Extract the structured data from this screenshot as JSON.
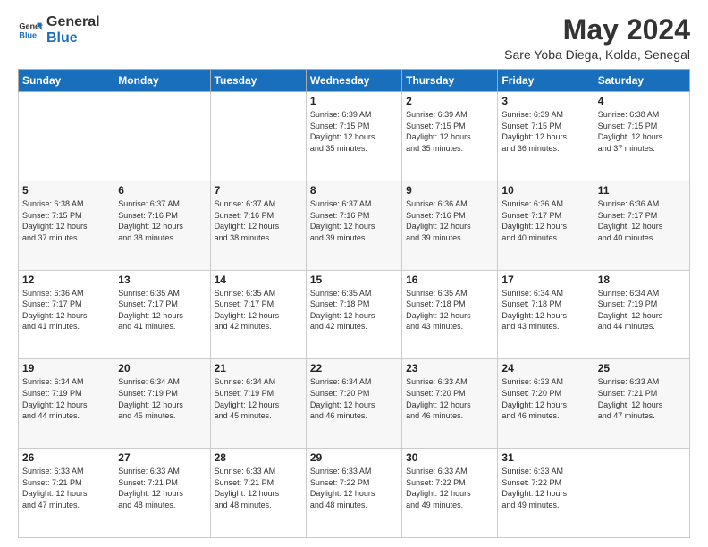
{
  "logo": {
    "line1": "General",
    "line2": "Blue"
  },
  "header": {
    "month_year": "May 2024",
    "location": "Sare Yoba Diega, Kolda, Senegal"
  },
  "days_of_week": [
    "Sunday",
    "Monday",
    "Tuesday",
    "Wednesday",
    "Thursday",
    "Friday",
    "Saturday"
  ],
  "weeks": [
    [
      {
        "day": "",
        "info": ""
      },
      {
        "day": "",
        "info": ""
      },
      {
        "day": "",
        "info": ""
      },
      {
        "day": "1",
        "info": "Sunrise: 6:39 AM\nSunset: 7:15 PM\nDaylight: 12 hours\nand 35 minutes."
      },
      {
        "day": "2",
        "info": "Sunrise: 6:39 AM\nSunset: 7:15 PM\nDaylight: 12 hours\nand 35 minutes."
      },
      {
        "day": "3",
        "info": "Sunrise: 6:39 AM\nSunset: 7:15 PM\nDaylight: 12 hours\nand 36 minutes."
      },
      {
        "day": "4",
        "info": "Sunrise: 6:38 AM\nSunset: 7:15 PM\nDaylight: 12 hours\nand 37 minutes."
      }
    ],
    [
      {
        "day": "5",
        "info": "Sunrise: 6:38 AM\nSunset: 7:15 PM\nDaylight: 12 hours\nand 37 minutes."
      },
      {
        "day": "6",
        "info": "Sunrise: 6:37 AM\nSunset: 7:16 PM\nDaylight: 12 hours\nand 38 minutes."
      },
      {
        "day": "7",
        "info": "Sunrise: 6:37 AM\nSunset: 7:16 PM\nDaylight: 12 hours\nand 38 minutes."
      },
      {
        "day": "8",
        "info": "Sunrise: 6:37 AM\nSunset: 7:16 PM\nDaylight: 12 hours\nand 39 minutes."
      },
      {
        "day": "9",
        "info": "Sunrise: 6:36 AM\nSunset: 7:16 PM\nDaylight: 12 hours\nand 39 minutes."
      },
      {
        "day": "10",
        "info": "Sunrise: 6:36 AM\nSunset: 7:17 PM\nDaylight: 12 hours\nand 40 minutes."
      },
      {
        "day": "11",
        "info": "Sunrise: 6:36 AM\nSunset: 7:17 PM\nDaylight: 12 hours\nand 40 minutes."
      }
    ],
    [
      {
        "day": "12",
        "info": "Sunrise: 6:36 AM\nSunset: 7:17 PM\nDaylight: 12 hours\nand 41 minutes."
      },
      {
        "day": "13",
        "info": "Sunrise: 6:35 AM\nSunset: 7:17 PM\nDaylight: 12 hours\nand 41 minutes."
      },
      {
        "day": "14",
        "info": "Sunrise: 6:35 AM\nSunset: 7:17 PM\nDaylight: 12 hours\nand 42 minutes."
      },
      {
        "day": "15",
        "info": "Sunrise: 6:35 AM\nSunset: 7:18 PM\nDaylight: 12 hours\nand 42 minutes."
      },
      {
        "day": "16",
        "info": "Sunrise: 6:35 AM\nSunset: 7:18 PM\nDaylight: 12 hours\nand 43 minutes."
      },
      {
        "day": "17",
        "info": "Sunrise: 6:34 AM\nSunset: 7:18 PM\nDaylight: 12 hours\nand 43 minutes."
      },
      {
        "day": "18",
        "info": "Sunrise: 6:34 AM\nSunset: 7:19 PM\nDaylight: 12 hours\nand 44 minutes."
      }
    ],
    [
      {
        "day": "19",
        "info": "Sunrise: 6:34 AM\nSunset: 7:19 PM\nDaylight: 12 hours\nand 44 minutes."
      },
      {
        "day": "20",
        "info": "Sunrise: 6:34 AM\nSunset: 7:19 PM\nDaylight: 12 hours\nand 45 minutes."
      },
      {
        "day": "21",
        "info": "Sunrise: 6:34 AM\nSunset: 7:19 PM\nDaylight: 12 hours\nand 45 minutes."
      },
      {
        "day": "22",
        "info": "Sunrise: 6:34 AM\nSunset: 7:20 PM\nDaylight: 12 hours\nand 46 minutes."
      },
      {
        "day": "23",
        "info": "Sunrise: 6:33 AM\nSunset: 7:20 PM\nDaylight: 12 hours\nand 46 minutes."
      },
      {
        "day": "24",
        "info": "Sunrise: 6:33 AM\nSunset: 7:20 PM\nDaylight: 12 hours\nand 46 minutes."
      },
      {
        "day": "25",
        "info": "Sunrise: 6:33 AM\nSunset: 7:21 PM\nDaylight: 12 hours\nand 47 minutes."
      }
    ],
    [
      {
        "day": "26",
        "info": "Sunrise: 6:33 AM\nSunset: 7:21 PM\nDaylight: 12 hours\nand 47 minutes."
      },
      {
        "day": "27",
        "info": "Sunrise: 6:33 AM\nSunset: 7:21 PM\nDaylight: 12 hours\nand 48 minutes."
      },
      {
        "day": "28",
        "info": "Sunrise: 6:33 AM\nSunset: 7:21 PM\nDaylight: 12 hours\nand 48 minutes."
      },
      {
        "day": "29",
        "info": "Sunrise: 6:33 AM\nSunset: 7:22 PM\nDaylight: 12 hours\nand 48 minutes."
      },
      {
        "day": "30",
        "info": "Sunrise: 6:33 AM\nSunset: 7:22 PM\nDaylight: 12 hours\nand 49 minutes."
      },
      {
        "day": "31",
        "info": "Sunrise: 6:33 AM\nSunset: 7:22 PM\nDaylight: 12 hours\nand 49 minutes."
      },
      {
        "day": "",
        "info": ""
      }
    ]
  ]
}
